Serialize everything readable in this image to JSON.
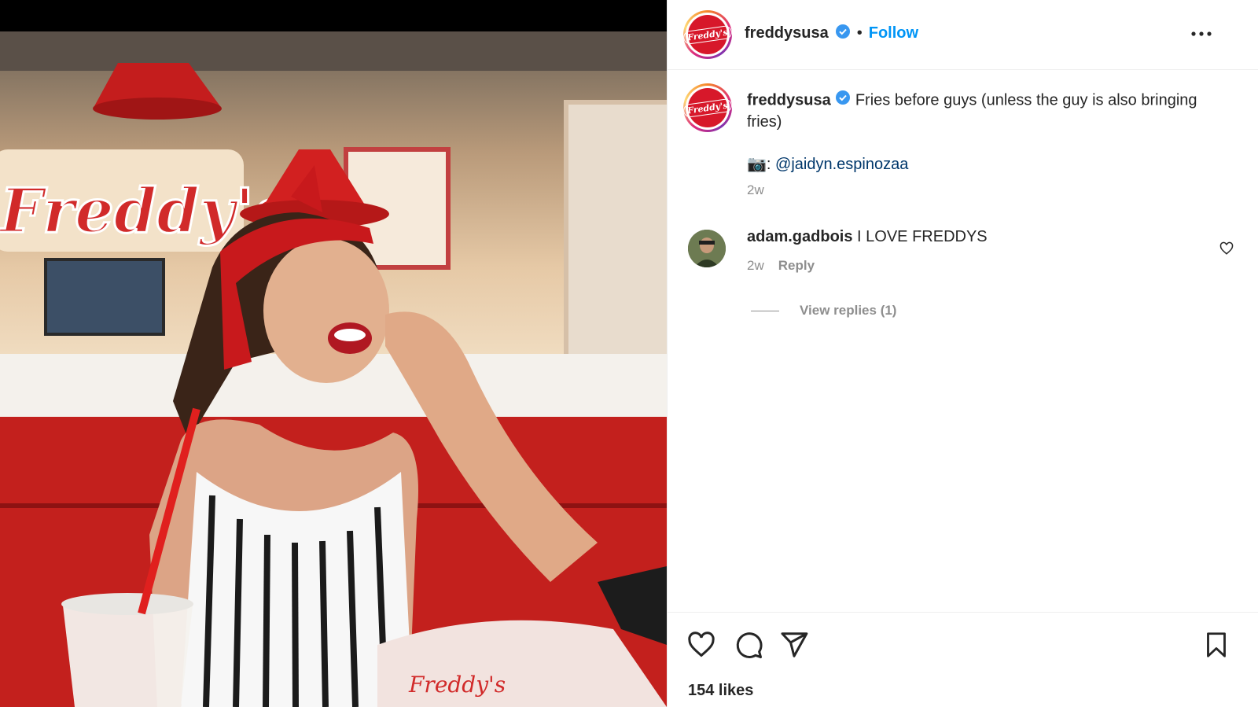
{
  "post": {
    "image_alt": "Woman in red bandana eating fries at Freddy's restaurant booth",
    "sign_text": "Freddy's"
  },
  "header": {
    "username": "freddysusa",
    "separator": "•",
    "follow_label": "Follow",
    "logo_text": "Freddy's"
  },
  "caption": {
    "username": "freddysusa",
    "text": "Fries before guys (unless the guy is also bringing fries)",
    "credit_prefix": "📷:",
    "credit_mention": "@jaidyn.espinozaa",
    "time": "2w"
  },
  "comment": {
    "username": "adam.gadbois",
    "text": "I LOVE FREDDYS",
    "time": "2w",
    "reply_label": "Reply",
    "view_replies": "View replies (1)"
  },
  "footer": {
    "likes": "154 likes"
  },
  "colors": {
    "brand_red": "#d7182a",
    "follow_blue": "#0095f6",
    "verified_blue": "#3897f0",
    "mention_blue": "#00376b"
  }
}
